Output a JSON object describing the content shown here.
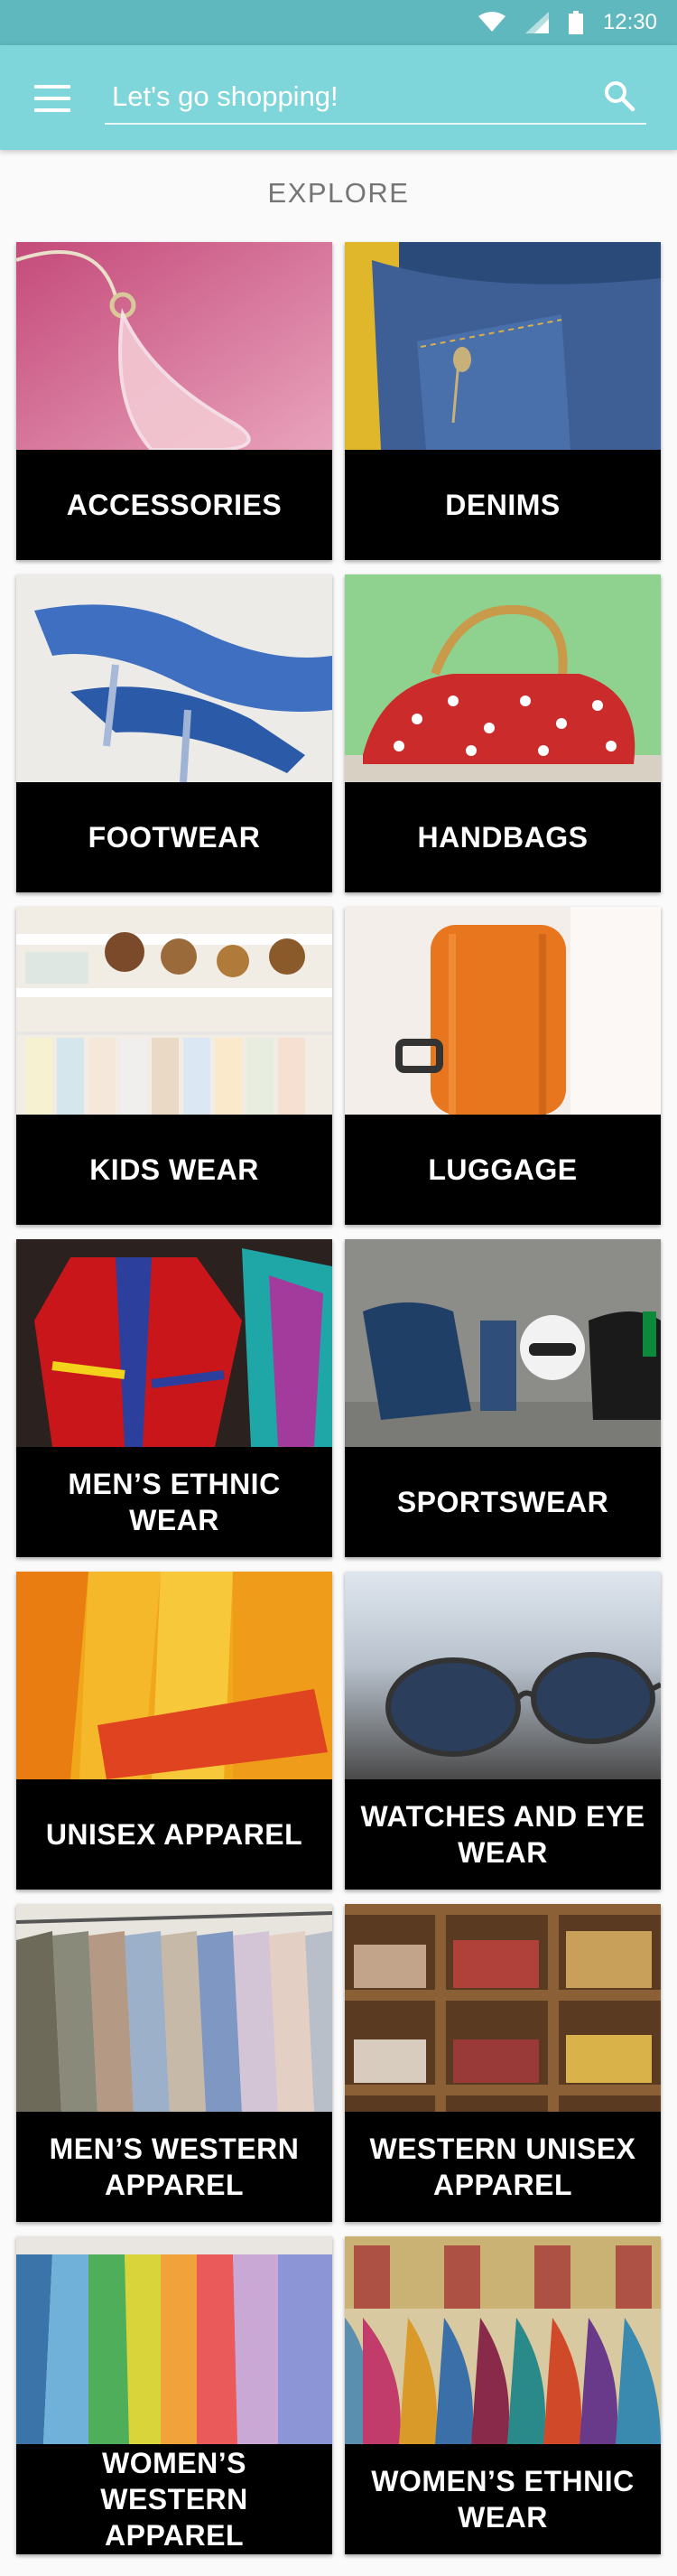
{
  "status_bar": {
    "time": "12:30"
  },
  "search": {
    "placeholder": "Let's go shopping!"
  },
  "section": {
    "title": "EXPLORE"
  },
  "categories": [
    {
      "label": "ACCESSORIES"
    },
    {
      "label": "DENIMS"
    },
    {
      "label": "FOOTWEAR"
    },
    {
      "label": "HANDBAGS"
    },
    {
      "label": "KIDS WEAR"
    },
    {
      "label": "LUGGAGE"
    },
    {
      "label": "MEN’S ETHNIC WEAR"
    },
    {
      "label": "SPORTSWEAR"
    },
    {
      "label": "UNISEX APPAREL"
    },
    {
      "label": "WATCHES AND EYE WEAR"
    },
    {
      "label": "MEN’S WESTERN APPAREL"
    },
    {
      "label": "WESTERN UNISEX APPAREL"
    },
    {
      "label": "WOMEN’S WESTERN APPAREL"
    },
    {
      "label": "WOMEN’S ETHNIC WEAR"
    }
  ],
  "colors": {
    "status_bar": "#5fb8bd",
    "app_bar": "#7fd6da",
    "label_bar": "#000000"
  },
  "icons": [
    "wifi-icon",
    "cell-signal-icon",
    "battery-icon",
    "menu-icon",
    "search-icon"
  ]
}
